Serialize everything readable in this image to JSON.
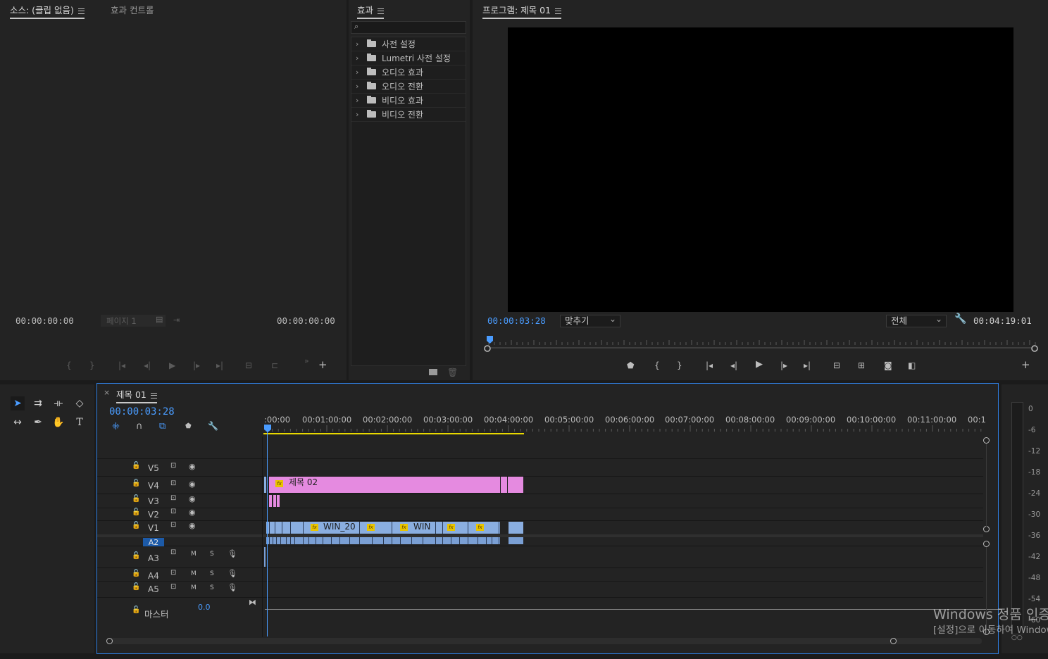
{
  "source_panel": {
    "tab_source": "소스: (클립 없음)",
    "tab_effect_controls": "효과 컨트롤",
    "timecode_left": "00:00:00:00",
    "page_label": "페이지 1",
    "timecode_right": "00:00:00:00"
  },
  "effects_panel": {
    "title": "효과",
    "search_placeholder": "",
    "items": [
      {
        "label": "사전 설정",
        "icon": "preset-folder-icon"
      },
      {
        "label": "Lumetri 사전 설정",
        "icon": "preset-folder-icon"
      },
      {
        "label": "오디오 효과",
        "icon": "folder-icon"
      },
      {
        "label": "오디오 전환",
        "icon": "folder-icon"
      },
      {
        "label": "비디오 효과",
        "icon": "folder-icon"
      },
      {
        "label": "비디오 전환",
        "icon": "folder-icon"
      }
    ]
  },
  "program_panel": {
    "title": "프로그램: 제목 01",
    "timecode_current": "00:00:03:28",
    "zoom_select": "맞추기",
    "quality_select": "전체",
    "timecode_duration": "00:04:19:01"
  },
  "timeline": {
    "tab_close": "×",
    "sequence_name": "제목 01",
    "timecode": "00:00:03:28",
    "ruler_labels": [
      ":00:00",
      "00:01:00:00",
      "00:02:00:00",
      "00:03:00:00",
      "00:04:00:00",
      "00:05:00:00",
      "00:06:00:00",
      "00:07:00:00",
      "00:08:00:00",
      "00:09:00:00",
      "00:10:00:00",
      "00:11:00:00",
      "00:1"
    ],
    "video_tracks": [
      "V5",
      "V4",
      "V3",
      "V2",
      "V1"
    ],
    "audio_tracks": [
      "A2",
      "A3",
      "A4",
      "A5"
    ],
    "audio_button_m": "M",
    "audio_button_s": "S",
    "master_label": "마스터",
    "master_value": "0.0",
    "clips": {
      "v4_title": "제목 02",
      "v1_clip_1": "WIN_20",
      "v1_clip_2": "WIN"
    },
    "fx_badge": "fx",
    "colors": {
      "video_clip": "#8aaee0",
      "title_clip": "#e58ae0",
      "accent": "#2f7ee0",
      "timecode": "#4a9cff",
      "work_area": "#e8d800"
    }
  },
  "audio_meter": {
    "labels": [
      "0",
      "-6",
      "-12",
      "-18",
      "-24",
      "-30",
      "-36",
      "-42",
      "-48",
      "-54",
      "-60"
    ]
  },
  "watermark": {
    "line1": "Windows 정품 인증",
    "line2": "[설정]으로 이동하여 Windows"
  }
}
